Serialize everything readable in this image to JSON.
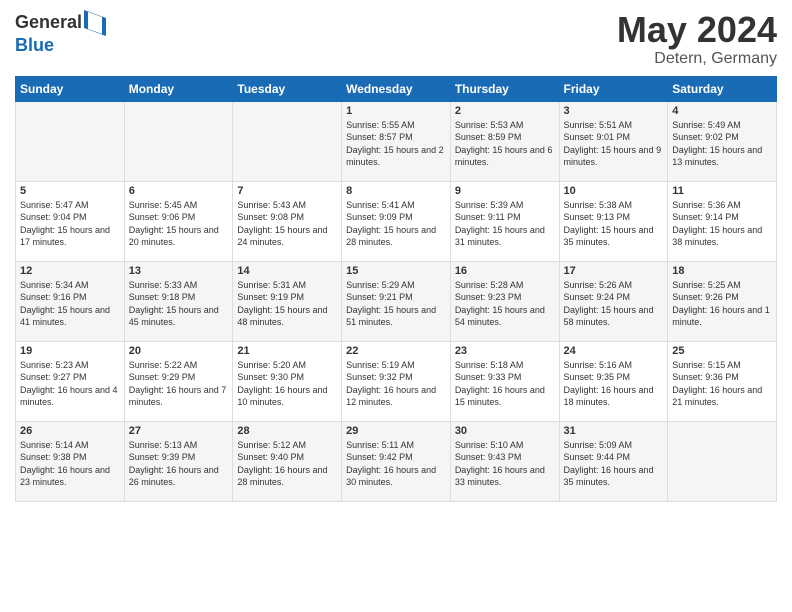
{
  "header": {
    "logo_general": "General",
    "logo_blue": "Blue",
    "month_title": "May 2024",
    "location": "Detern, Germany"
  },
  "days_of_week": [
    "Sunday",
    "Monday",
    "Tuesday",
    "Wednesday",
    "Thursday",
    "Friday",
    "Saturday"
  ],
  "weeks": [
    [
      {
        "day": "",
        "info": ""
      },
      {
        "day": "",
        "info": ""
      },
      {
        "day": "",
        "info": ""
      },
      {
        "day": "1",
        "info": "Sunrise: 5:55 AM\nSunset: 8:57 PM\nDaylight: 15 hours\nand 2 minutes."
      },
      {
        "day": "2",
        "info": "Sunrise: 5:53 AM\nSunset: 8:59 PM\nDaylight: 15 hours\nand 6 minutes."
      },
      {
        "day": "3",
        "info": "Sunrise: 5:51 AM\nSunset: 9:01 PM\nDaylight: 15 hours\nand 9 minutes."
      },
      {
        "day": "4",
        "info": "Sunrise: 5:49 AM\nSunset: 9:02 PM\nDaylight: 15 hours\nand 13 minutes."
      }
    ],
    [
      {
        "day": "5",
        "info": "Sunrise: 5:47 AM\nSunset: 9:04 PM\nDaylight: 15 hours\nand 17 minutes."
      },
      {
        "day": "6",
        "info": "Sunrise: 5:45 AM\nSunset: 9:06 PM\nDaylight: 15 hours\nand 20 minutes."
      },
      {
        "day": "7",
        "info": "Sunrise: 5:43 AM\nSunset: 9:08 PM\nDaylight: 15 hours\nand 24 minutes."
      },
      {
        "day": "8",
        "info": "Sunrise: 5:41 AM\nSunset: 9:09 PM\nDaylight: 15 hours\nand 28 minutes."
      },
      {
        "day": "9",
        "info": "Sunrise: 5:39 AM\nSunset: 9:11 PM\nDaylight: 15 hours\nand 31 minutes."
      },
      {
        "day": "10",
        "info": "Sunrise: 5:38 AM\nSunset: 9:13 PM\nDaylight: 15 hours\nand 35 minutes."
      },
      {
        "day": "11",
        "info": "Sunrise: 5:36 AM\nSunset: 9:14 PM\nDaylight: 15 hours\nand 38 minutes."
      }
    ],
    [
      {
        "day": "12",
        "info": "Sunrise: 5:34 AM\nSunset: 9:16 PM\nDaylight: 15 hours\nand 41 minutes."
      },
      {
        "day": "13",
        "info": "Sunrise: 5:33 AM\nSunset: 9:18 PM\nDaylight: 15 hours\nand 45 minutes."
      },
      {
        "day": "14",
        "info": "Sunrise: 5:31 AM\nSunset: 9:19 PM\nDaylight: 15 hours\nand 48 minutes."
      },
      {
        "day": "15",
        "info": "Sunrise: 5:29 AM\nSunset: 9:21 PM\nDaylight: 15 hours\nand 51 minutes."
      },
      {
        "day": "16",
        "info": "Sunrise: 5:28 AM\nSunset: 9:23 PM\nDaylight: 15 hours\nand 54 minutes."
      },
      {
        "day": "17",
        "info": "Sunrise: 5:26 AM\nSunset: 9:24 PM\nDaylight: 15 hours\nand 58 minutes."
      },
      {
        "day": "18",
        "info": "Sunrise: 5:25 AM\nSunset: 9:26 PM\nDaylight: 16 hours\nand 1 minute."
      }
    ],
    [
      {
        "day": "19",
        "info": "Sunrise: 5:23 AM\nSunset: 9:27 PM\nDaylight: 16 hours\nand 4 minutes."
      },
      {
        "day": "20",
        "info": "Sunrise: 5:22 AM\nSunset: 9:29 PM\nDaylight: 16 hours\nand 7 minutes."
      },
      {
        "day": "21",
        "info": "Sunrise: 5:20 AM\nSunset: 9:30 PM\nDaylight: 16 hours\nand 10 minutes."
      },
      {
        "day": "22",
        "info": "Sunrise: 5:19 AM\nSunset: 9:32 PM\nDaylight: 16 hours\nand 12 minutes."
      },
      {
        "day": "23",
        "info": "Sunrise: 5:18 AM\nSunset: 9:33 PM\nDaylight: 16 hours\nand 15 minutes."
      },
      {
        "day": "24",
        "info": "Sunrise: 5:16 AM\nSunset: 9:35 PM\nDaylight: 16 hours\nand 18 minutes."
      },
      {
        "day": "25",
        "info": "Sunrise: 5:15 AM\nSunset: 9:36 PM\nDaylight: 16 hours\nand 21 minutes."
      }
    ],
    [
      {
        "day": "26",
        "info": "Sunrise: 5:14 AM\nSunset: 9:38 PM\nDaylight: 16 hours\nand 23 minutes."
      },
      {
        "day": "27",
        "info": "Sunrise: 5:13 AM\nSunset: 9:39 PM\nDaylight: 16 hours\nand 26 minutes."
      },
      {
        "day": "28",
        "info": "Sunrise: 5:12 AM\nSunset: 9:40 PM\nDaylight: 16 hours\nand 28 minutes."
      },
      {
        "day": "29",
        "info": "Sunrise: 5:11 AM\nSunset: 9:42 PM\nDaylight: 16 hours\nand 30 minutes."
      },
      {
        "day": "30",
        "info": "Sunrise: 5:10 AM\nSunset: 9:43 PM\nDaylight: 16 hours\nand 33 minutes."
      },
      {
        "day": "31",
        "info": "Sunrise: 5:09 AM\nSunset: 9:44 PM\nDaylight: 16 hours\nand 35 minutes."
      },
      {
        "day": "",
        "info": ""
      }
    ]
  ]
}
